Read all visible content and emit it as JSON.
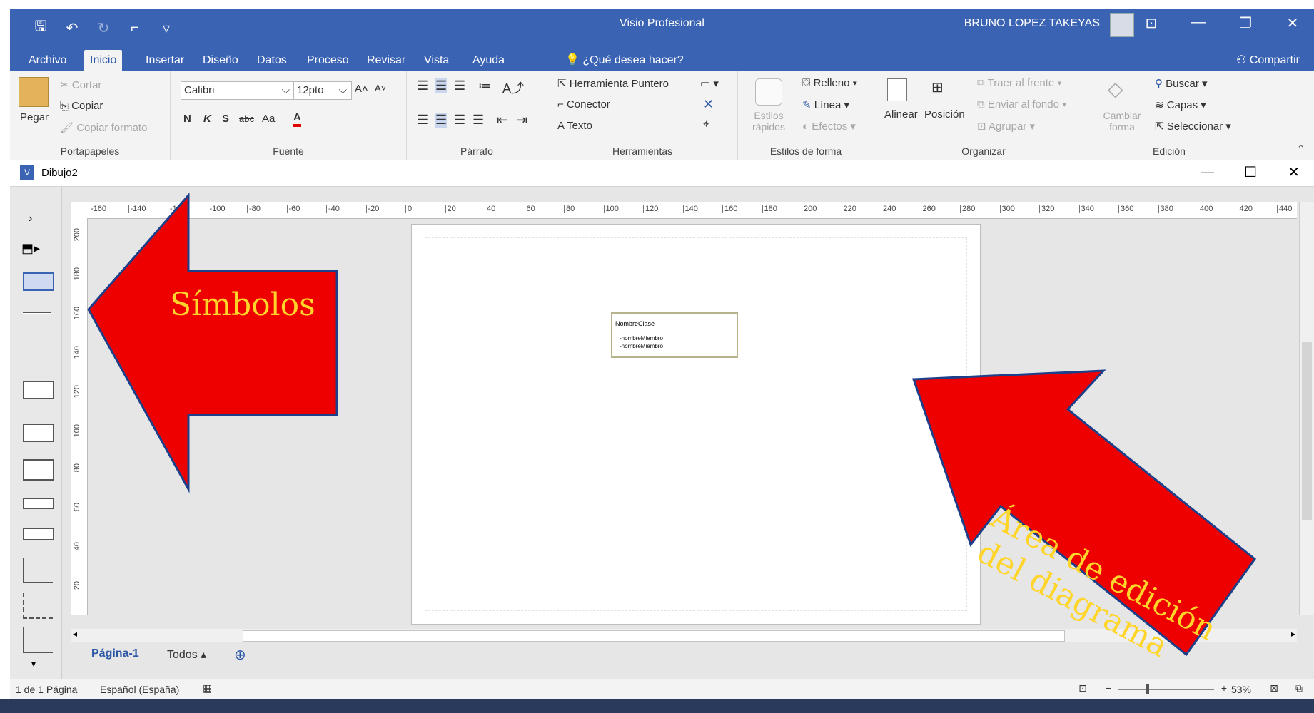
{
  "titlebar": {
    "app_title": "Visio Profesional",
    "user_name": "BRUNO LOPEZ TAKEYAS"
  },
  "tabs": [
    {
      "label": "Archivo"
    },
    {
      "label": "Inicio",
      "active": true
    },
    {
      "label": "Insertar"
    },
    {
      "label": "Diseño"
    },
    {
      "label": "Datos"
    },
    {
      "label": "Proceso"
    },
    {
      "label": "Revisar"
    },
    {
      "label": "Vista"
    },
    {
      "label": "Ayuda"
    }
  ],
  "tell_me": "¿Qué desea hacer?",
  "share": "Compartir",
  "ribbon": {
    "clipboard": {
      "paste": "Pegar",
      "cut": "Cortar",
      "copy": "Copiar",
      "format_painter": "Copiar formato",
      "group": "Portapapeles"
    },
    "font": {
      "name": "Calibri",
      "size": "12pto",
      "bold": "N",
      "italic": "K",
      "underline": "S",
      "strike": "abc",
      "case": "Aa",
      "color": "A",
      "group": "Fuente"
    },
    "paragraph": {
      "group": "Párrafo"
    },
    "tools": {
      "pointer": "Herramienta Puntero",
      "connector": "Conector",
      "text": "Texto",
      "group": "Herramientas"
    },
    "shape_styles": {
      "quick": "Estilos rápidos",
      "fill": "Relleno",
      "line": "Línea",
      "effects": "Efectos",
      "group": "Estilos de forma"
    },
    "arrange": {
      "align": "Alinear",
      "position": "Posición",
      "bring_front": "Traer al frente",
      "send_back": "Enviar al fondo",
      "group_btn": "Agrupar",
      "group": "Organizar"
    },
    "editing": {
      "change_shape": "Cambiar forma",
      "find": "Buscar",
      "layers": "Capas",
      "select": "Seleccionar",
      "group": "Edición"
    }
  },
  "document": {
    "name": "Dibujo2"
  },
  "ruler_top_labels": [
    "-160",
    "-140",
    "-120",
    "-100",
    "-80",
    "-60",
    "-40",
    "-20",
    "0",
    "20",
    "40",
    "60",
    "80",
    "100",
    "120",
    "140",
    "160",
    "180",
    "200",
    "220",
    "240",
    "260",
    "280",
    "300",
    "320",
    "340",
    "360",
    "380",
    "400",
    "420",
    "440"
  ],
  "ruler_left_labels": [
    "200",
    "180",
    "160",
    "140",
    "120",
    "100",
    "80",
    "60",
    "40",
    "20"
  ],
  "uml_class": {
    "name": "NombreClase",
    "members": [
      "-nombreMiembro",
      "-nombreMiembro"
    ]
  },
  "page_tabs": {
    "current": "Página-1",
    "all": "Todos"
  },
  "status": {
    "page_count": "1 de 1 Página",
    "language": "Español (España)",
    "zoom": "53%"
  },
  "annotations": {
    "symbols": "Símbolos",
    "edit_area_line1": "Área de edición",
    "edit_area_line2": "del diagrama"
  },
  "colors": {
    "accent": "#3b63b3",
    "arrow": "#ee0000",
    "arrow_text": "#ffd52a"
  }
}
